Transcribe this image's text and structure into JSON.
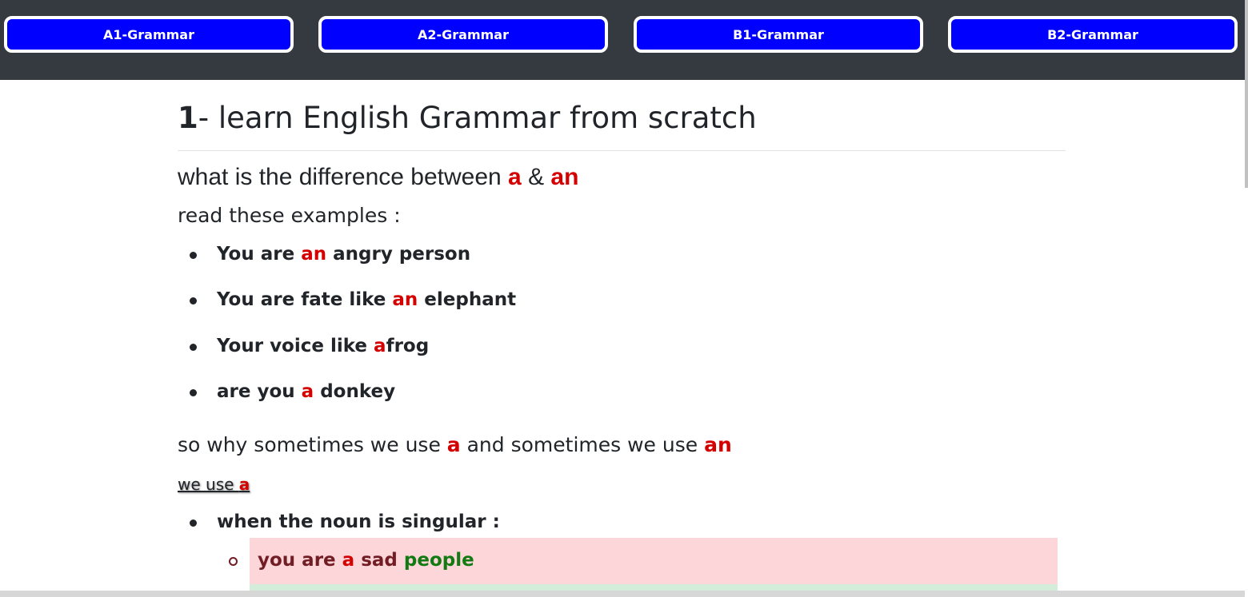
{
  "nav": {
    "buttons": [
      "A1-Grammar",
      "A2-Grammar",
      "B1-Grammar",
      "B2-Grammar"
    ]
  },
  "content": {
    "title_number": "1",
    "title_rest": "- learn English Grammar from scratch",
    "question_prefix": "what is the difference between ",
    "question_a": "a",
    "question_amp": " & ",
    "question_an": "an",
    "read_examples": "read these examples :",
    "examples": [
      {
        "pre": "You are ",
        "art": "an",
        "post": " angry person"
      },
      {
        "pre": "You are fate like ",
        "art": "an",
        "post": " elephant"
      },
      {
        "pre": "Your voice like ",
        "art": "a",
        "post": "frog"
      },
      {
        "pre": "are you ",
        "art": "a",
        "post": " donkey"
      }
    ],
    "why_pre": "so why sometimes we use ",
    "why_a": "a",
    "why_mid": " and sometimes we use ",
    "why_an": "an",
    "we_use": "we use ",
    "we_use_a": "a",
    "singular_rule": "when the noun is singular :",
    "alert_example": {
      "pre": "you are ",
      "art": "a",
      "mid": " sad ",
      "noun": "people"
    }
  },
  "colors": {
    "nav_button": "#0000ff",
    "topbar": "#343a40",
    "highlight": "#d40000",
    "alert_bg": "#fdd6da",
    "success": "#127a12"
  }
}
